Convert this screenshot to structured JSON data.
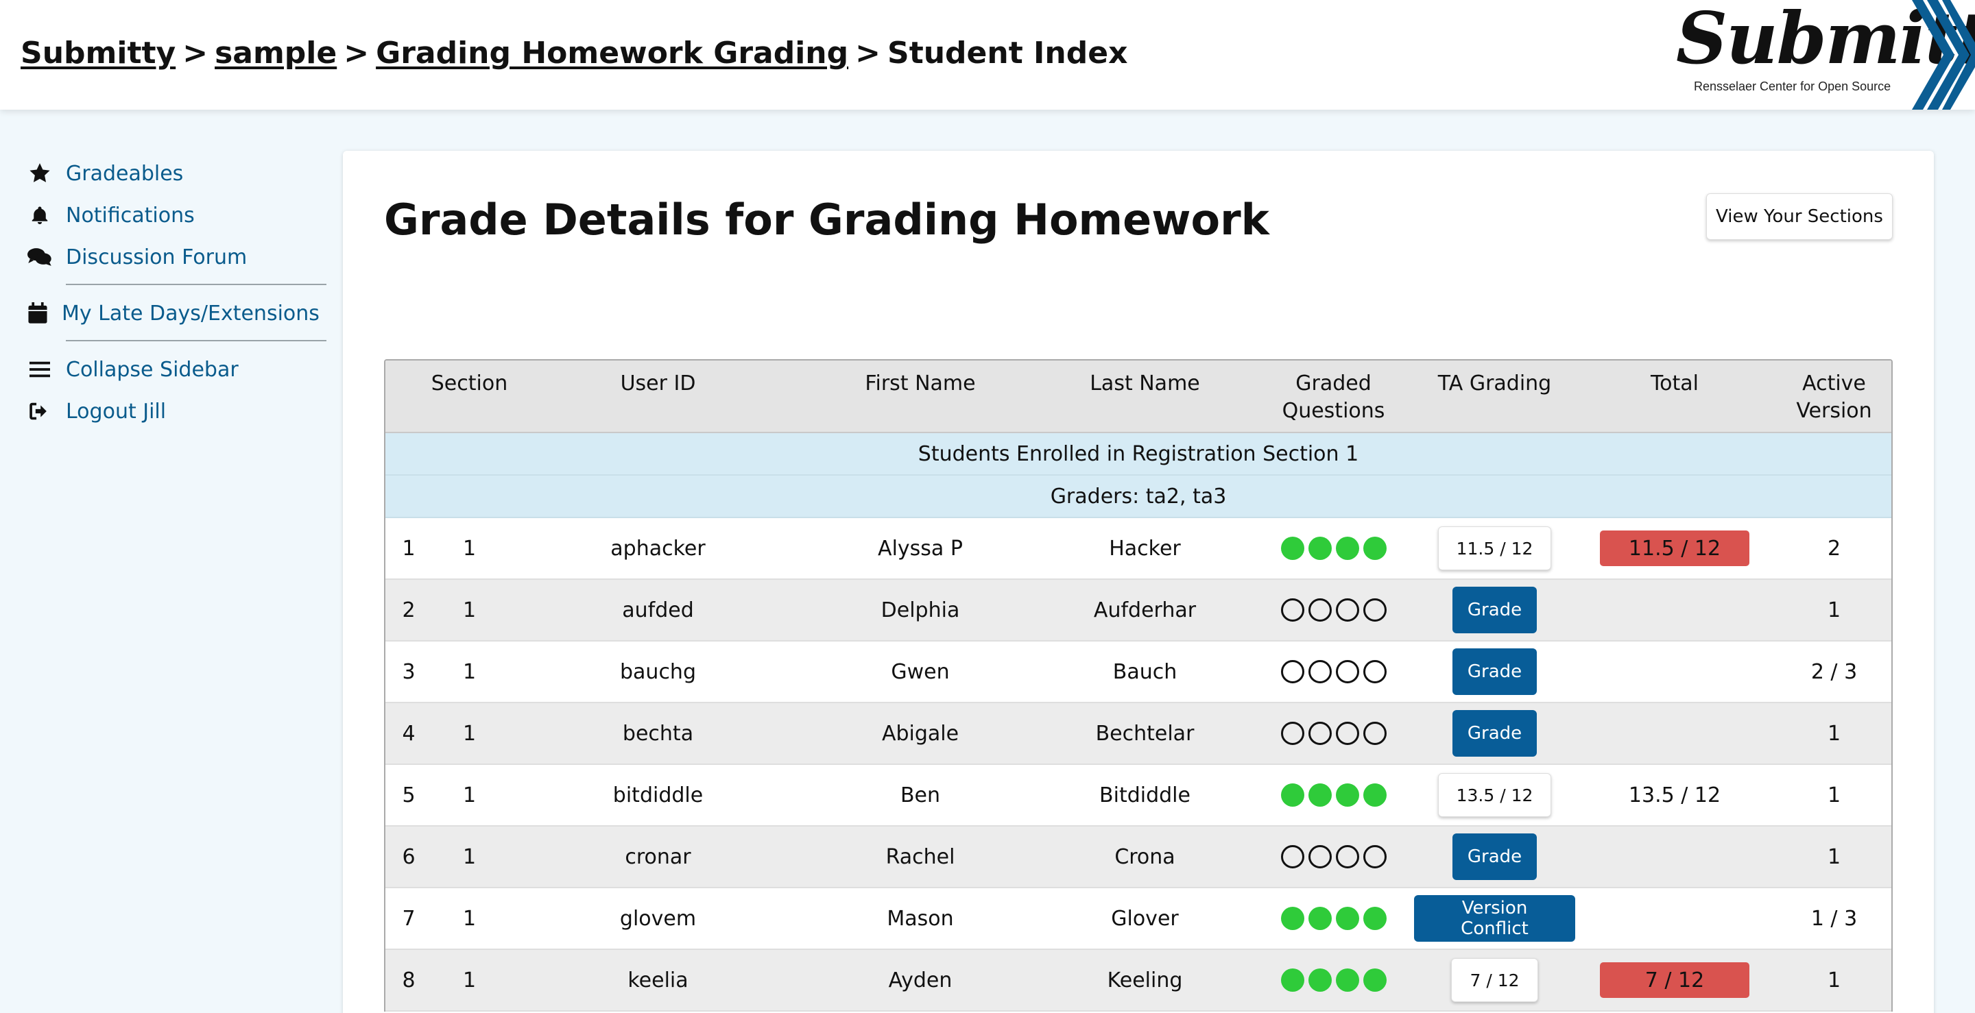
{
  "breadcrumbs": [
    {
      "label": "Submitty",
      "link": true
    },
    {
      "label": "sample",
      "link": true
    },
    {
      "label": "Grading Homework Grading",
      "link": true
    },
    {
      "label": "Student Index",
      "link": false
    }
  ],
  "breadcrumb_separator": ">",
  "logo": {
    "word": "Submitty",
    "subtitle": "Rensselaer Center for Open Source"
  },
  "sidebar": {
    "items": [
      {
        "label": "Gradeables",
        "icon": "star-icon"
      },
      {
        "label": "Notifications",
        "icon": "bell-icon"
      },
      {
        "label": "Discussion Forum",
        "icon": "comments-icon"
      },
      {
        "label": "My Late Days/Extensions",
        "icon": "calendar-icon"
      },
      {
        "label": "Collapse Sidebar",
        "icon": "bars-icon"
      },
      {
        "label": "Logout Jill",
        "icon": "logout-icon"
      }
    ]
  },
  "main": {
    "title": "Grade Details for Grading Homework",
    "view_sections_label": "View Your Sections"
  },
  "table": {
    "headers": {
      "num": "",
      "section": "Section",
      "user_id": "User ID",
      "first_name": "First Name",
      "last_name": "Last Name",
      "graded_line1": "Graded",
      "graded_line2": "Questions",
      "ta_grading": "TA Grading",
      "total": "Total",
      "active_version": "Active Version"
    },
    "section_title": "Students Enrolled in Registration Section 1",
    "graders": "Graders: ta2, ta3",
    "rows": [
      {
        "num": "1",
        "section": "1",
        "user_id": "aphacker",
        "first": "Alyssa P",
        "last": "Hacker",
        "graded": [
          1,
          1,
          1,
          1
        ],
        "ta_type": "score",
        "ta": "11.5 / 12",
        "total": "11.5 / 12",
        "total_red": true,
        "active": "2"
      },
      {
        "num": "2",
        "section": "1",
        "user_id": "aufded",
        "first": "Delphia",
        "last": "Aufderhar",
        "graded": [
          0,
          0,
          0,
          0
        ],
        "ta_type": "grade",
        "ta": "Grade",
        "total": "",
        "total_red": false,
        "active": "1"
      },
      {
        "num": "3",
        "section": "1",
        "user_id": "bauchg",
        "first": "Gwen",
        "last": "Bauch",
        "graded": [
          0,
          0,
          0,
          0
        ],
        "ta_type": "grade",
        "ta": "Grade",
        "total": "",
        "total_red": false,
        "active": "2 / 3"
      },
      {
        "num": "4",
        "section": "1",
        "user_id": "bechta",
        "first": "Abigale",
        "last": "Bechtelar",
        "graded": [
          0,
          0,
          0,
          0
        ],
        "ta_type": "grade",
        "ta": "Grade",
        "total": "",
        "total_red": false,
        "active": "1"
      },
      {
        "num": "5",
        "section": "1",
        "user_id": "bitdiddle",
        "first": "Ben",
        "last": "Bitdiddle",
        "graded": [
          1,
          1,
          1,
          1
        ],
        "ta_type": "score",
        "ta": "13.5 / 12",
        "total": "13.5 / 12",
        "total_red": false,
        "active": "1"
      },
      {
        "num": "6",
        "section": "1",
        "user_id": "cronar",
        "first": "Rachel",
        "last": "Crona",
        "graded": [
          0,
          0,
          0,
          0
        ],
        "ta_type": "grade",
        "ta": "Grade",
        "total": "",
        "total_red": false,
        "active": "1"
      },
      {
        "num": "7",
        "section": "1",
        "user_id": "glovem",
        "first": "Mason",
        "last": "Glover",
        "graded": [
          1,
          1,
          1,
          1
        ],
        "ta_type": "grade",
        "ta": "Version Conflict",
        "total": "",
        "total_red": false,
        "active": "1 / 3"
      },
      {
        "num": "8",
        "section": "1",
        "user_id": "keelia",
        "first": "Ayden",
        "last": "Keeling",
        "graded": [
          1,
          1,
          1,
          1
        ],
        "ta_type": "score",
        "ta": "7 / 12",
        "total": "7 / 12",
        "total_red": true,
        "active": "1"
      }
    ]
  },
  "colors": {
    "link": "#0a5b8c",
    "grade_button": "#085d98",
    "graded_dot": "#2fcb3a",
    "total_red": "#d9534f",
    "section_header": "#d6ebf5"
  }
}
